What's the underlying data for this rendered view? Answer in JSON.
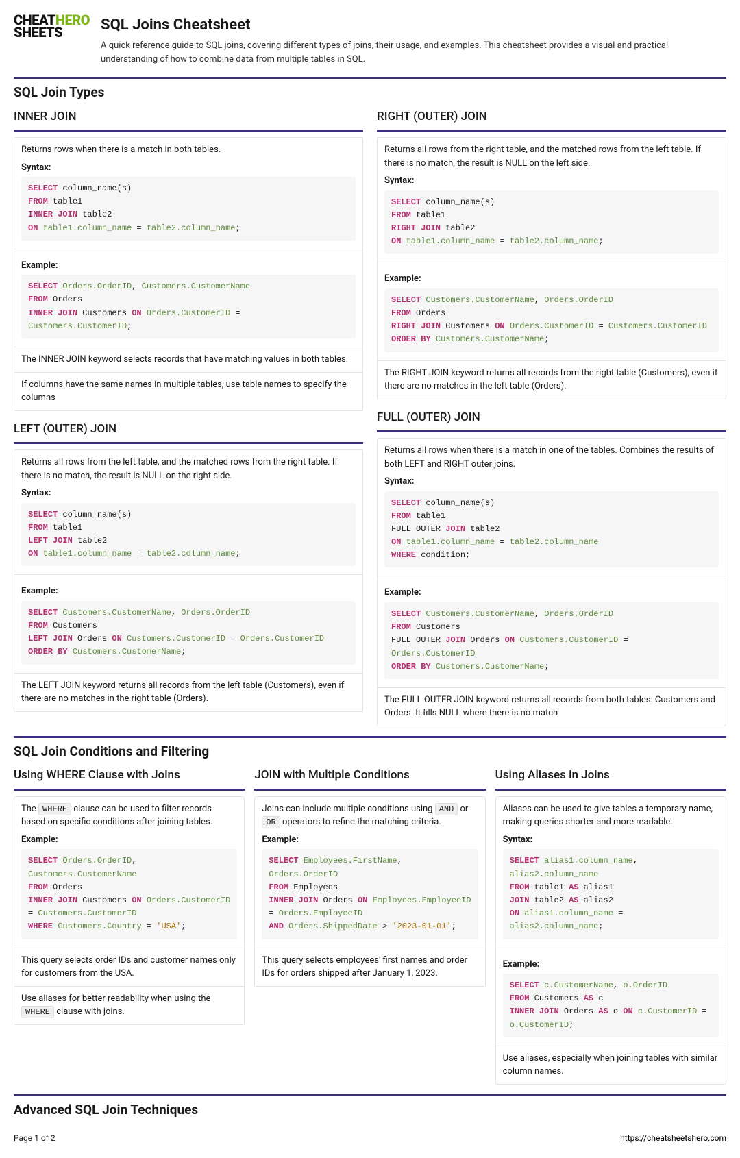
{
  "logo": {
    "t1": "CHEAT",
    "t2": "HERO",
    "t3": "SHEETS"
  },
  "header": {
    "title": "SQL Joins Cheatsheet",
    "subtitle": "A quick reference guide to SQL joins, covering different types of joins, their usage, and examples. This cheatsheet provides a visual and practical understanding of how to combine data from multiple tables in SQL."
  },
  "s1": {
    "heading": "SQL Join Types"
  },
  "inner": {
    "title": "INNER JOIN",
    "desc": "Returns rows when there is a match in both tables.",
    "syntax_label": "Syntax:",
    "example_label": "Example:",
    "note1": "The INNER JOIN keyword selects records that have matching values in both tables.",
    "note2": "If columns have the same names in multiple tables, use table names to specify the columns"
  },
  "left": {
    "title": "LEFT (OUTER) JOIN",
    "desc": "Returns all rows from the left table, and the matched rows from the right table. If there is no match, the result is NULL on the right side.",
    "syntax_label": "Syntax:",
    "example_label": "Example:",
    "note1": "The LEFT JOIN keyword returns all records from the left table (Customers), even if there are no matches in the right table (Orders)."
  },
  "right": {
    "title": "RIGHT (OUTER) JOIN",
    "desc": "Returns all rows from the right table, and the matched rows from the left table. If there is no match, the result is NULL on the left side.",
    "syntax_label": "Syntax:",
    "example_label": "Example:",
    "note1": "The RIGHT JOIN keyword returns all records from the right table (Customers), even if there are no matches in the left table (Orders)."
  },
  "full": {
    "title": "FULL (OUTER) JOIN",
    "desc": "Returns all rows when there is a match in one of the tables. Combines the results of both LEFT and RIGHT outer joins.",
    "syntax_label": "Syntax:",
    "example_label": "Example:",
    "note1": "The FULL OUTER JOIN keyword returns all records from both tables: Customers and Orders. It fills NULL where there is no match"
  },
  "s2": {
    "heading": "SQL Join Conditions and Filtering"
  },
  "where": {
    "title": "Using WHERE Clause with Joins",
    "desc_pre": "The ",
    "desc_code": "WHERE",
    "desc_post": " clause can be used to filter records based on specific conditions after joining tables.",
    "example_label": "Example:",
    "note1": "This query selects order IDs and customer names only for customers from the USA.",
    "note2_pre": "Use aliases for better readability when using the ",
    "note2_code": "WHERE",
    "note2_post": " clause with joins."
  },
  "multi": {
    "title": "JOIN with Multiple Conditions",
    "desc_pre": "Joins can include multiple conditions using ",
    "desc_and": "AND",
    "desc_mid": " or ",
    "desc_or": "OR",
    "desc_post": " operators to refine the matching criteria.",
    "example_label": "Example:",
    "note1": "This query selects employees' first names and order IDs for orders shipped after January 1, 2023."
  },
  "alias": {
    "title": "Using Aliases in Joins",
    "desc": "Aliases can be used to give tables a temporary name, making queries shorter and more readable.",
    "syntax_label": "Syntax:",
    "example_label": "Example:",
    "note1": "Use aliases, especially when joining tables with similar column names."
  },
  "s3": {
    "heading": "Advanced SQL Join Techniques"
  },
  "footer": {
    "page": "Page 1 of 2",
    "url": "https://cheatsheetshero.com"
  }
}
